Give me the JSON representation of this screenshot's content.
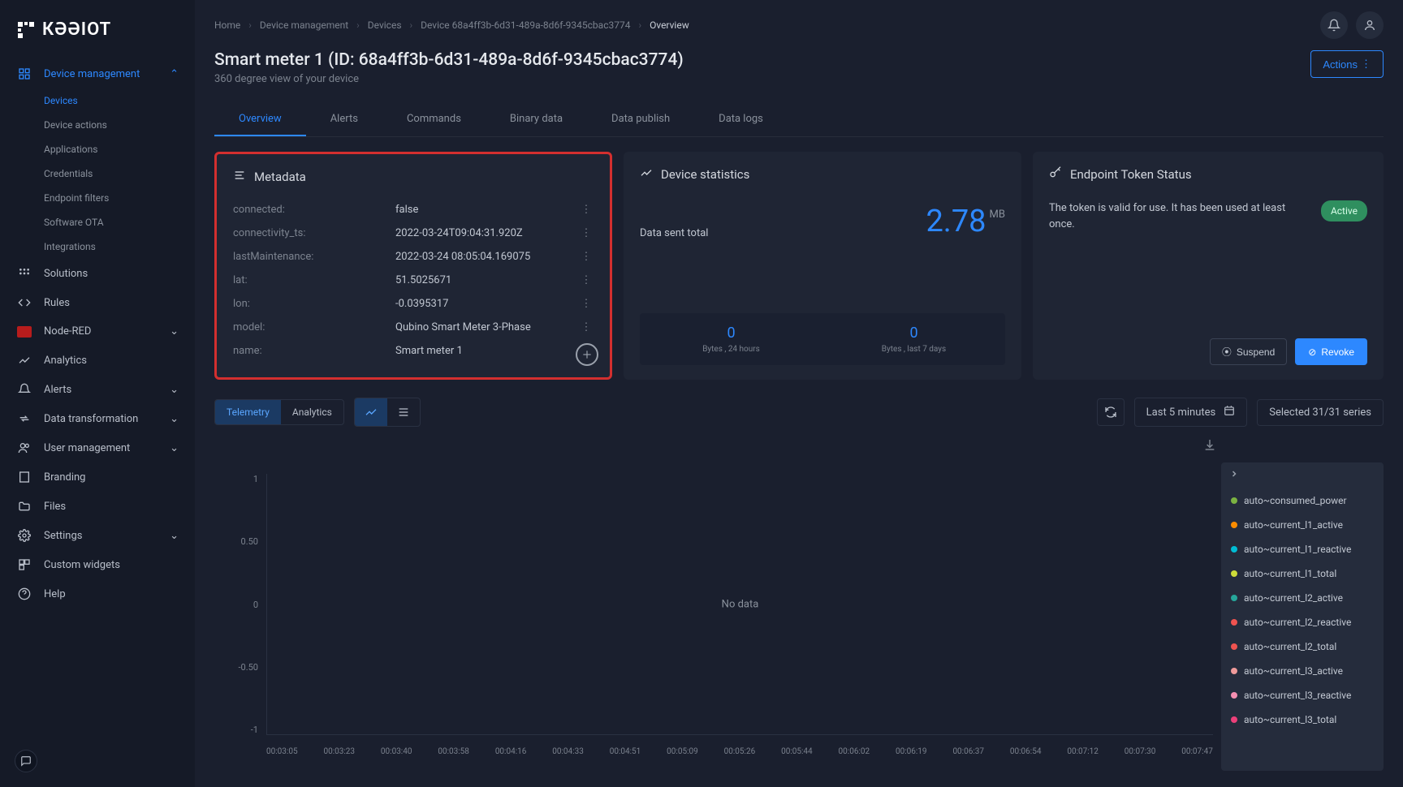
{
  "logo_text": "КƏƏIOT",
  "sidebar": {
    "items": [
      {
        "label": "Device management",
        "icon": "grid",
        "active": true,
        "expandable": true,
        "expanded": true
      },
      {
        "label": "Solutions",
        "icon": "apps"
      },
      {
        "label": "Rules",
        "icon": "code"
      },
      {
        "label": "Node-RED",
        "icon": "nodered",
        "expandable": true
      },
      {
        "label": "Analytics",
        "icon": "trend"
      },
      {
        "label": "Alerts",
        "icon": "bell",
        "expandable": true
      },
      {
        "label": "Data transformation",
        "icon": "transform",
        "expandable": true
      },
      {
        "label": "User management",
        "icon": "users",
        "expandable": true
      },
      {
        "label": "Branding",
        "icon": "building"
      },
      {
        "label": "Files",
        "icon": "folder"
      },
      {
        "label": "Settings",
        "icon": "gear",
        "expandable": true
      },
      {
        "label": "Custom widgets",
        "icon": "widgets"
      },
      {
        "label": "Help",
        "icon": "help"
      }
    ],
    "sub_devicemgmt": [
      {
        "label": "Devices",
        "active": true
      },
      {
        "label": "Device actions"
      },
      {
        "label": "Applications"
      },
      {
        "label": "Credentials"
      },
      {
        "label": "Endpoint filters"
      },
      {
        "label": "Software OTA"
      },
      {
        "label": "Integrations"
      }
    ]
  },
  "breadcrumb": [
    {
      "label": "Home"
    },
    {
      "label": "Device management"
    },
    {
      "label": "Devices"
    },
    {
      "label": "Device 68a4ff3b-6d31-489a-8d6f-9345cbac3774"
    },
    {
      "label": "Overview",
      "current": true
    }
  ],
  "page": {
    "title": "Smart meter 1 (ID: 68a4ff3b-6d31-489a-8d6f-9345cbac3774)",
    "subtitle": "360 degree view of your device",
    "actions_label": "Actions"
  },
  "tabs": [
    {
      "label": "Overview",
      "active": true
    },
    {
      "label": "Alerts"
    },
    {
      "label": "Commands"
    },
    {
      "label": "Binary data"
    },
    {
      "label": "Data publish"
    },
    {
      "label": "Data logs"
    }
  ],
  "metadata": {
    "title": "Metadata",
    "rows": [
      {
        "key": "connected:",
        "value": "false"
      },
      {
        "key": "connectivity_ts:",
        "value": "2022-03-24T09:04:31.920Z"
      },
      {
        "key": "lastMaintenance:",
        "value": "2022-03-24 08:05:04.169075"
      },
      {
        "key": "lat:",
        "value": "51.5025671"
      },
      {
        "key": "lon:",
        "value": "-0.0395317"
      },
      {
        "key": "model:",
        "value": "Qubino Smart Meter 3-Phase"
      },
      {
        "key": "name:",
        "value": "Smart meter 1"
      }
    ]
  },
  "stats": {
    "title": "Device statistics",
    "main_label": "Data sent total",
    "main_value": "2.78",
    "main_unit": "MB",
    "cells": [
      {
        "value": "0",
        "label": "Bytes , 24 hours"
      },
      {
        "value": "0",
        "label": "Bytes , last 7 days"
      }
    ]
  },
  "token": {
    "title": "Endpoint Token Status",
    "text": "The token is valid for use. It has been used at least once.",
    "badge": "Active",
    "suspend": "Suspend",
    "revoke": "Revoke"
  },
  "toolbar": {
    "seg": [
      "Telemetry",
      "Analytics"
    ],
    "range": "Last 5 minutes",
    "series": "Selected 31/31 series"
  },
  "chart_data": {
    "type": "line",
    "title": "",
    "ylim": [
      -1,
      1
    ],
    "yticks": [
      "1",
      "0.50",
      "0",
      "-0.50",
      "-1"
    ],
    "xticks": [
      "00:03:05",
      "00:03:23",
      "00:03:40",
      "00:03:58",
      "00:04:16",
      "00:04:33",
      "00:04:51",
      "00:05:09",
      "00:05:26",
      "00:05:44",
      "00:06:02",
      "00:06:19",
      "00:06:37",
      "00:06:54",
      "00:07:12",
      "00:07:30",
      "00:07:47"
    ],
    "series": [],
    "no_data": "No data"
  },
  "legend": [
    {
      "label": "auto~consumed_power",
      "color": "#7cb342"
    },
    {
      "label": "auto~current_l1_active",
      "color": "#fb8c00"
    },
    {
      "label": "auto~current_l1_reactive",
      "color": "#00bcd4"
    },
    {
      "label": "auto~current_l1_total",
      "color": "#cddc39"
    },
    {
      "label": "auto~current_l2_active",
      "color": "#26a69a"
    },
    {
      "label": "auto~current_l2_reactive",
      "color": "#ef5350"
    },
    {
      "label": "auto~current_l2_total",
      "color": "#ef5350"
    },
    {
      "label": "auto~current_l3_active",
      "color": "#ef9a9a"
    },
    {
      "label": "auto~current_l3_reactive",
      "color": "#f48fb1"
    },
    {
      "label": "auto~current_l3_total",
      "color": "#ec407a"
    }
  ]
}
